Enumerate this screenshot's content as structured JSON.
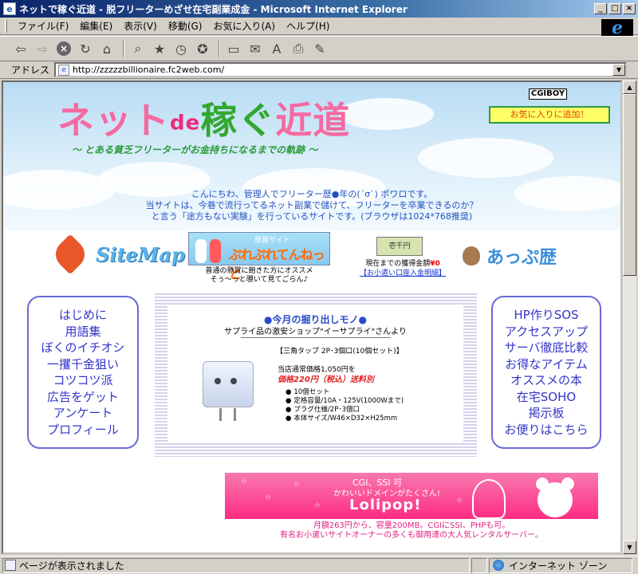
{
  "window": {
    "title": "ネットで稼ぐ近道 - 脱フリーターめざせ在宅副業成金 - Microsoft Internet Explorer",
    "controls": [
      "_",
      "□",
      "×"
    ]
  },
  "menu": [
    "ファイル(F)",
    "編集(E)",
    "表示(V)",
    "移動(G)",
    "お気に入り(A)",
    "ヘルプ(H)"
  ],
  "address": {
    "label": "アドレス",
    "url": "http://zzzzzbillionaire.fc2web.com/"
  },
  "header": {
    "logo_a": "ネット",
    "logo_de": "de",
    "logo_b": "稼ぐ",
    "logo_c": "近道",
    "subtitle": "～ とある貧乏フリーターがお金持ちになるまでの軌跡 ～",
    "cgiboy": "CGIBOY",
    "favorite_button": "お気に入りに追加！",
    "intro_lines": [
      "こんにちわ、管理人でフリーター歴●年の(´σ`) ポワロです。",
      "当サイトは、今巷で流行ってるネット副業で儲けて、フリーターを卒業できるのか？",
      "と言う「途方もない実験」を行っているサイトです。(ブラウザは1024*768推奨)"
    ]
  },
  "nav_banners": {
    "sitemap": "SiteMap",
    "banner_small": "懸賞サイト",
    "banner_main": "ぷれぷれてんねっと",
    "banner_caption": [
      "普通の懸賞に飽きた方にオススメ",
      "そぅ～っと覗いて見てごらん♪"
    ],
    "money_note": "壱千円",
    "earnings_label": "現在までの獲得金額",
    "earnings_value": "¥0",
    "earnings_link": "【お小遣い口座入金明細】",
    "appureki": "あっぷ歴"
  },
  "left_nav": [
    "はじめに",
    "用語集",
    "ぼくのイチオシ",
    "一攫千金狙い",
    "コツコツ派",
    "広告をゲット",
    "アンケート",
    "プロフィール"
  ],
  "right_nav": [
    "HP作りSOS",
    "アクセスアップ",
    "サーバ徹底比較",
    "お得なアイテム",
    "オススメの本",
    "在宅SOHO",
    "掲示板",
    "お便りはこちら"
  ],
  "featured": {
    "title": "●今月の掘り出しモノ●",
    "subtitle": "サプライ品の激安ショップ\"イーサプライ\"さんより",
    "product_name": "【三角タップ 2P･3個口(10個セット)】",
    "list_price": "当店通常価格1,050円を",
    "sale_price": "価格220円（税込）送料別",
    "specs": [
      "10個セット",
      "定格容量/10A・125V(1000Wまで)",
      "プラグ仕様/2P･3個口",
      "本体サイズ/W46×D32×H25mm"
    ]
  },
  "lolipop": {
    "line1": "CGI、SSI 可",
    "line2": "かわいいドメインがたくさん!",
    "brand": "Lolipop!",
    "caption": [
      "月額263円から、容量200MB。CGIにSSI、PHPも可。",
      "有名お小遣いサイトオーナーの多くも御用達の大人気レンタルサーバー。"
    ]
  },
  "status": {
    "text": "ページが表示されました",
    "zone": "インターネット ゾーン"
  },
  "colors": {
    "nav_text": "#3434ca",
    "nav_border": "#6a6ad8",
    "logo_pink": "#f56aa0",
    "logo_green": "#32a830"
  }
}
